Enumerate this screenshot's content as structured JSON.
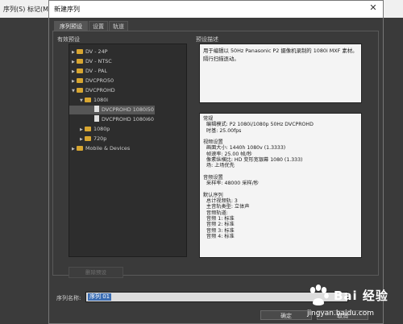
{
  "background": {
    "menu": [
      "序列(S)",
      "标记(M)"
    ]
  },
  "dialog": {
    "title": "新建序列",
    "close_glyph": "✕",
    "tabs": [
      {
        "label": "序列预设",
        "active": true
      },
      {
        "label": "设置",
        "active": false
      },
      {
        "label": "轨道",
        "active": false
      }
    ],
    "available_presets_label": "有效预设",
    "preset_desc_label": "预设描述",
    "tree": [
      {
        "label": "DV - 24P",
        "level": 0,
        "type": "folder",
        "expanded": false
      },
      {
        "label": "DV - NTSC",
        "level": 0,
        "type": "folder",
        "expanded": false
      },
      {
        "label": "DV - PAL",
        "level": 0,
        "type": "folder",
        "expanded": false
      },
      {
        "label": "DVCPRO50",
        "level": 0,
        "type": "folder",
        "expanded": false
      },
      {
        "label": "DVCPROHD",
        "level": 0,
        "type": "folder",
        "expanded": true
      },
      {
        "label": "1080i",
        "level": 1,
        "type": "folder",
        "expanded": true
      },
      {
        "label": "DVCPROHD 1080i50",
        "level": 2,
        "type": "file",
        "selected": true
      },
      {
        "label": "DVCPROHD 1080i60",
        "level": 2,
        "type": "file",
        "selected": false
      },
      {
        "label": "1080p",
        "level": 1,
        "type": "folder",
        "expanded": false
      },
      {
        "label": "720p",
        "level": 1,
        "type": "folder",
        "expanded": false
      },
      {
        "label": "Mobile & Devices",
        "level": 0,
        "type": "folder",
        "expanded": false
      }
    ],
    "description": "用于编辑以 50Hz Panasonic P2 摄像机录制的 1080i MXF 素材。\n隔行扫描逐动。",
    "details": "常规\n  编辑模式: P2 1080i/1080p 50Hz DVCPROHD\n  时基: 25.00fps\n\n视频设置\n  画面大小: 1440h 1080v (1.3333)\n  帧速率: 25.00 帧/秒\n  像素纵横比: HD 变形宽银幕 1080 (1.333)\n  场: 上场优先\n\n音频设置\n  采样率: 48000 采样/秒\n\n默认序列\n  总计视频轨: 3\n  主音轨类型: 立体声\n  音频轨道:\n  音频 1: 标准\n  音频 2: 标准\n  音频 3: 标准\n  音频 4: 标准",
    "delete_preset_label": "删除预设",
    "sequence_name_label": "序列名称:",
    "sequence_name_value": "序列 01",
    "ok_label": "确定",
    "cancel_label": "取消"
  },
  "watermark": {
    "brand": "Bai  经验",
    "url": "jingyan.baidu.com"
  }
}
